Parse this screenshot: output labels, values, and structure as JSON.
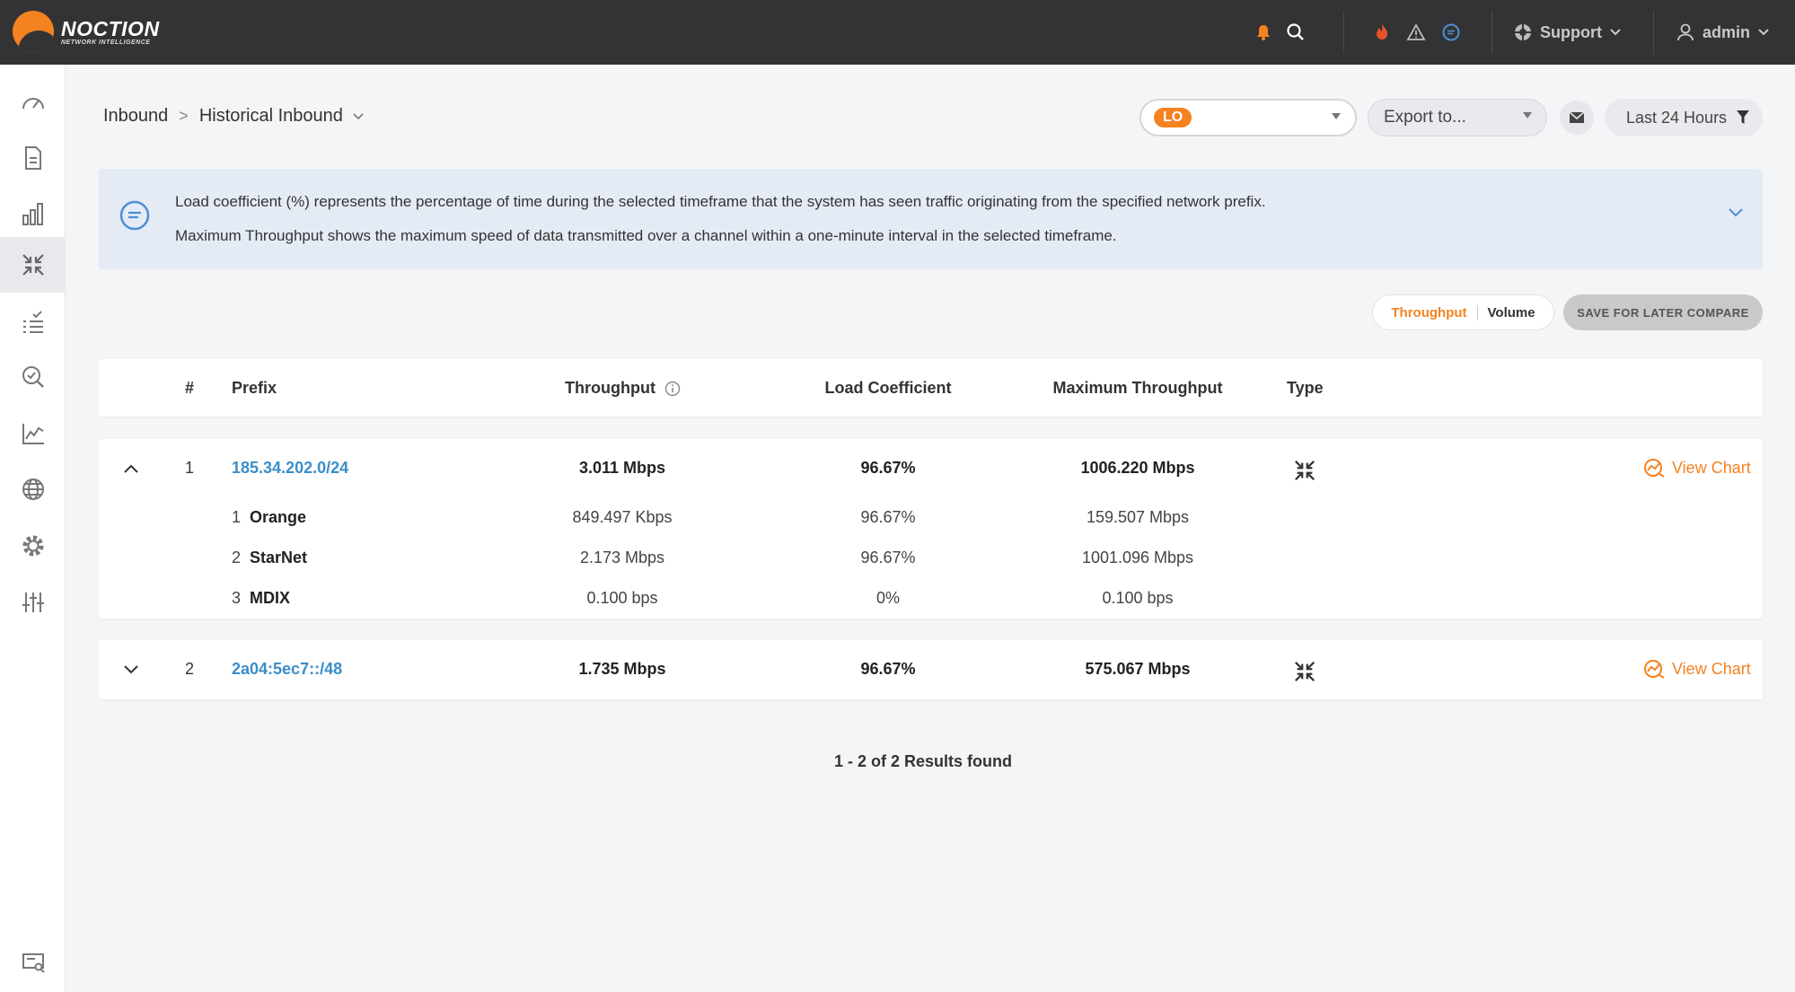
{
  "brand": {
    "name": "NOCTION",
    "tagline": "NETWORK INTELLIGENCE",
    "accent": "#f58220"
  },
  "topbar": {
    "icons": [
      "bell-icon",
      "search-icon",
      "flame-icon",
      "warning-icon",
      "chat-icon"
    ],
    "support_label": "Support",
    "user_label": "admin"
  },
  "sidebar": {
    "items": [
      "dashboard-icon",
      "report-icon",
      "bar-chart-icon",
      "inbound-arrows-icon",
      "checklist-icon",
      "analyzer-icon",
      "graph-icon",
      "globe-icon",
      "settings-icon",
      "sliders-icon"
    ],
    "active_index": 3,
    "bottom": "monitor-icon"
  },
  "breadcrumb": {
    "root": "Inbound",
    "separator": ">",
    "current": "Historical Inbound"
  },
  "filters": {
    "lo_badge": "LO",
    "export_label": "Export to...",
    "period_label": "Last 24 Hours"
  },
  "info": {
    "line1": "Load coefficient (%) represents the percentage of time during the selected timeframe that the system has seen traffic originating from the specified network prefix.",
    "line2": "Maximum Throughput shows the maximum speed of data transmitted over a channel within a one-minute interval in the selected timeframe."
  },
  "toggle": {
    "throughput": "Throughput",
    "volume": "Volume",
    "active": "Throughput"
  },
  "save_label": "SAVE FOR LATER COMPARE",
  "table": {
    "headers": {
      "num": "#",
      "prefix": "Prefix",
      "throughput": "Throughput",
      "load": "Load Coefficient",
      "max": "Maximum Throughput",
      "type": "Type"
    },
    "rows": [
      {
        "num": "1",
        "prefix": "185.34.202.0/24",
        "throughput": "3.011 Mbps",
        "load": "96.67%",
        "max": "1006.220 Mbps",
        "expanded": true,
        "view_chart": "View Chart",
        "providers": [
          {
            "num": "1",
            "name": "Orange",
            "throughput": "849.497 Kbps",
            "load": "96.67%",
            "max": "159.507 Mbps"
          },
          {
            "num": "2",
            "name": "StarNet",
            "throughput": "2.173 Mbps",
            "load": "96.67%",
            "max": "1001.096 Mbps"
          },
          {
            "num": "3",
            "name": "MDIX",
            "throughput": "0.100 bps",
            "load": "0%",
            "max": "0.100 bps"
          }
        ]
      },
      {
        "num": "2",
        "prefix": "2a04:5ec7::/48",
        "throughput": "1.735 Mbps",
        "load": "96.67%",
        "max": "575.067 Mbps",
        "expanded": false,
        "view_chart": "View Chart"
      }
    ]
  },
  "results_text": "1 - 2 of 2 Results found"
}
